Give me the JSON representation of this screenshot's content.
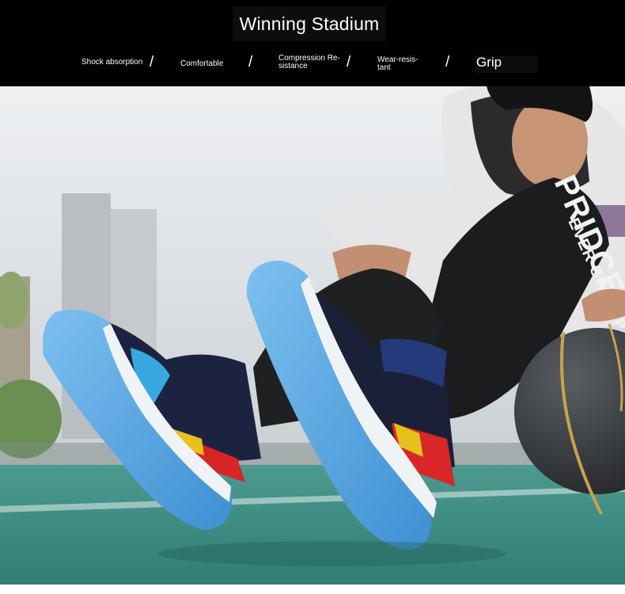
{
  "header": {
    "title": "Winning Stadium",
    "features": [
      {
        "line1": "Shock absorption",
        "line2": ""
      },
      {
        "line1": "Comfortable",
        "line2": ""
      },
      {
        "line1": "Compression Re-",
        "line2": "sistance"
      },
      {
        "line1": "Wear-resis-",
        "line2": "tant"
      },
      {
        "line1": "Grip",
        "line2": ""
      }
    ],
    "separator": "/"
  },
  "photo": {
    "leggings_text_1": "PRIDCE",
    "leggings_text_2": "EVER GIVE UP",
    "colors": {
      "sky": "#dfe3e6",
      "court": "#3f8f86",
      "hoodie": "#e4e4e6",
      "shoe_sole": "#5aa6e0",
      "ball": "#3a3d40"
    }
  }
}
